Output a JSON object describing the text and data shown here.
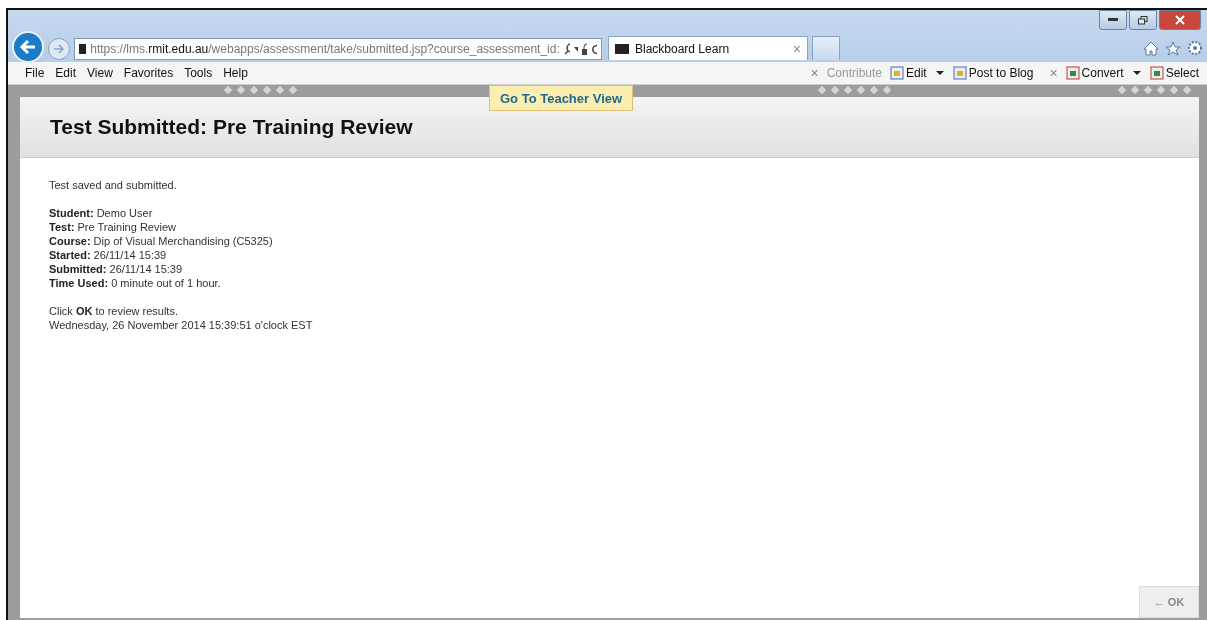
{
  "address_bar": {
    "url": "https://lms.**rmit.edu.au**/webapps/assessment/take/submitted.jsp?course_assessment_id:"
  },
  "tabs": [
    {
      "label": "Blackboard Learn",
      "selected": true,
      "close": "×"
    }
  ],
  "menu": [
    "File",
    "Edit",
    "View",
    "Favorites",
    "Tools",
    "Help"
  ],
  "toolbar": [
    {
      "kind": "close",
      "label": "×"
    },
    {
      "kind": "button",
      "label": "Contribute",
      "disabled": true
    },
    {
      "kind": "button",
      "label": "Edit",
      "disabled": false,
      "dropdown": true
    },
    {
      "kind": "button",
      "label": "Post to Blog",
      "disabled": false
    },
    {
      "kind": "close",
      "label": "×"
    },
    {
      "kind": "button",
      "label": "Convert",
      "disabled": false,
      "dropdown": true
    },
    {
      "kind": "button",
      "label": "Select",
      "disabled": false
    }
  ],
  "teacher_view_button": "Go To Teacher View",
  "page": {
    "title": "Test Submitted: Pre Training Review",
    "status": "Test saved and submitted.",
    "details": [
      "**Student:** Demo User",
      "**Test:** Pre Training Review",
      "**Course:** Dip of Visual Merchandising (C5325)",
      "**Started:** 26/11/14 15:39",
      "**Submitted:** 26/11/14 15:39",
      "**Time Used:** 0 minute out of 1 hour."
    ],
    "footer": [
      "Click **OK** to review results.",
      "Wednesday, 26 November 2014 15:39:51 o'clock EST"
    ],
    "ok_button": "← OK"
  }
}
